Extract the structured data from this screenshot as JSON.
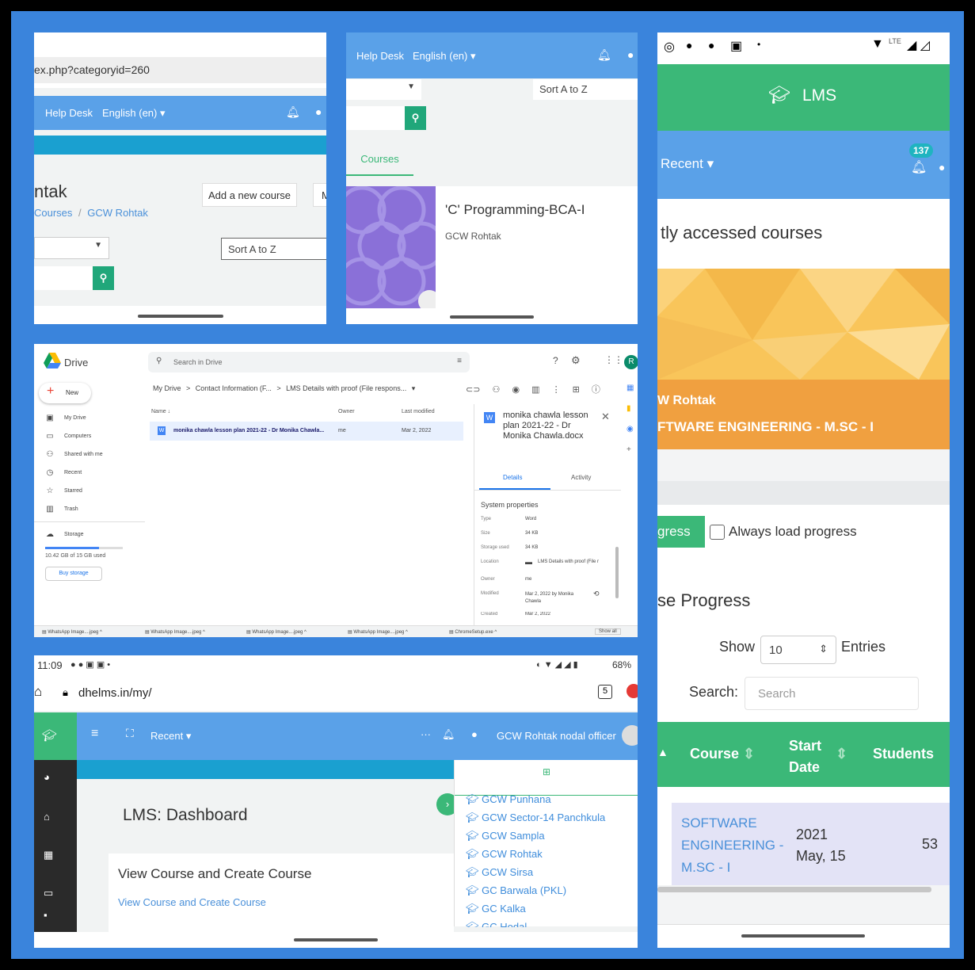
{
  "p1": {
    "url": "ex.php?categoryid=260",
    "help_desk": "Help Desk",
    "language": "English (en)",
    "page_title": "ntak",
    "breadcrumb_courses": "Courses",
    "breadcrumb_sep": "/",
    "breadcrumb_current": "GCW Rohtak",
    "add_course": "Add a new course",
    "cut_btn": "M",
    "sort_value": "Sort A to Z"
  },
  "p2": {
    "help_desk": "Help Desk",
    "language": "English (en)",
    "sort_value": "Sort A to Z",
    "tab_courses": "Courses",
    "course_title": "'C' Programming-BCA-I",
    "course_category": "GCW Rohtak"
  },
  "p3": {
    "app_title": "LMS",
    "recent": "Recent",
    "badge": "137",
    "heading": "tly accessed courses",
    "card_line1": "W Rohtak",
    "card_line2": "FTWARE ENGINEERING - M.SC - I",
    "progress_btn": "gress",
    "checkbox_label": "Always load progress",
    "section_heading": "se Progress",
    "show_label": "Show",
    "show_value": "10",
    "entries_label": "Entries",
    "search_label": "Search:",
    "search_placeholder": "Search",
    "table": {
      "headers": [
        "Course",
        "Start Date",
        "Students"
      ],
      "row": {
        "course": "SOFTWARE ENGINEERING - M.SC - I",
        "start_year": "2021",
        "start_day": "May, 15",
        "students": "53"
      }
    },
    "status_lte": "LTE"
  },
  "p4": {
    "app_name": "Drive",
    "search_placeholder": "Search in Drive",
    "new_btn": "New",
    "nav": [
      "My Drive",
      "Computers",
      "Shared with me",
      "Recent",
      "Starred",
      "Trash"
    ],
    "storage_label": "Storage",
    "storage_used": "10.42 GB of 15 GB used",
    "storage_fraction": 0.69,
    "buy_storage": "Buy storage",
    "breadcrumb": [
      "My Drive",
      ">",
      "Contact Information (F...",
      ">",
      "LMS Details with proof (File respons..."
    ],
    "columns": [
      "Name",
      "Owner",
      "Last modified"
    ],
    "file": {
      "name": "monika chawla lesson plan 2021-22 - Dr Monika Chawla...",
      "owner": "me",
      "modified": "Mar 2, 2022"
    },
    "details_title": "monika chawla lesson plan 2021-22 - Dr Monika Chawla.docx",
    "tab_details": "Details",
    "tab_activity": "Activity",
    "system_props": "System properties",
    "props": [
      {
        "k": "Type",
        "v": "Word"
      },
      {
        "k": "Size",
        "v": "34 KB"
      },
      {
        "k": "Storage used",
        "v": "34 KB"
      },
      {
        "k": "Location",
        "v": "LMS Details with proof (File r"
      },
      {
        "k": "Owner",
        "v": "me"
      },
      {
        "k": "Modified",
        "v": "Mar 2, 2022 by Monika Chawla"
      },
      {
        "k": "Created",
        "v": "Mar 2, 2022"
      }
    ],
    "downloads": [
      "WhatsApp Image....jpeg",
      "WhatsApp Image....jpeg",
      "WhatsApp Image....jpeg",
      "WhatsApp Image....jpeg",
      "ChromeSetup.exe"
    ],
    "show_all": "Show all",
    "avatar_letter": "R"
  },
  "p5": {
    "time": "11:09",
    "battery": "68%",
    "url": "dhelms.in/my/",
    "tabs_count": "5",
    "recent": "Recent",
    "user": "GCW Rohtak nodal officer",
    "dashboard_title": "LMS: Dashboard",
    "card_title": "View Course and Create Course",
    "card_link": "View Course and Create Course",
    "colleges": [
      "GCW Punhana",
      "GCW Sector-14 Panchkula",
      "GCW Sampla",
      "GCW Rohtak",
      "GCW Sirsa",
      "GC Barwala (PKL)",
      "GC Kalka",
      "GC Hodal"
    ]
  },
  "colors": {
    "frame": "#3a84dc",
    "navbar": "#5aa1e8",
    "green": "#3bb878",
    "orange": "#f0a040",
    "teal": "#1aa0d0"
  }
}
